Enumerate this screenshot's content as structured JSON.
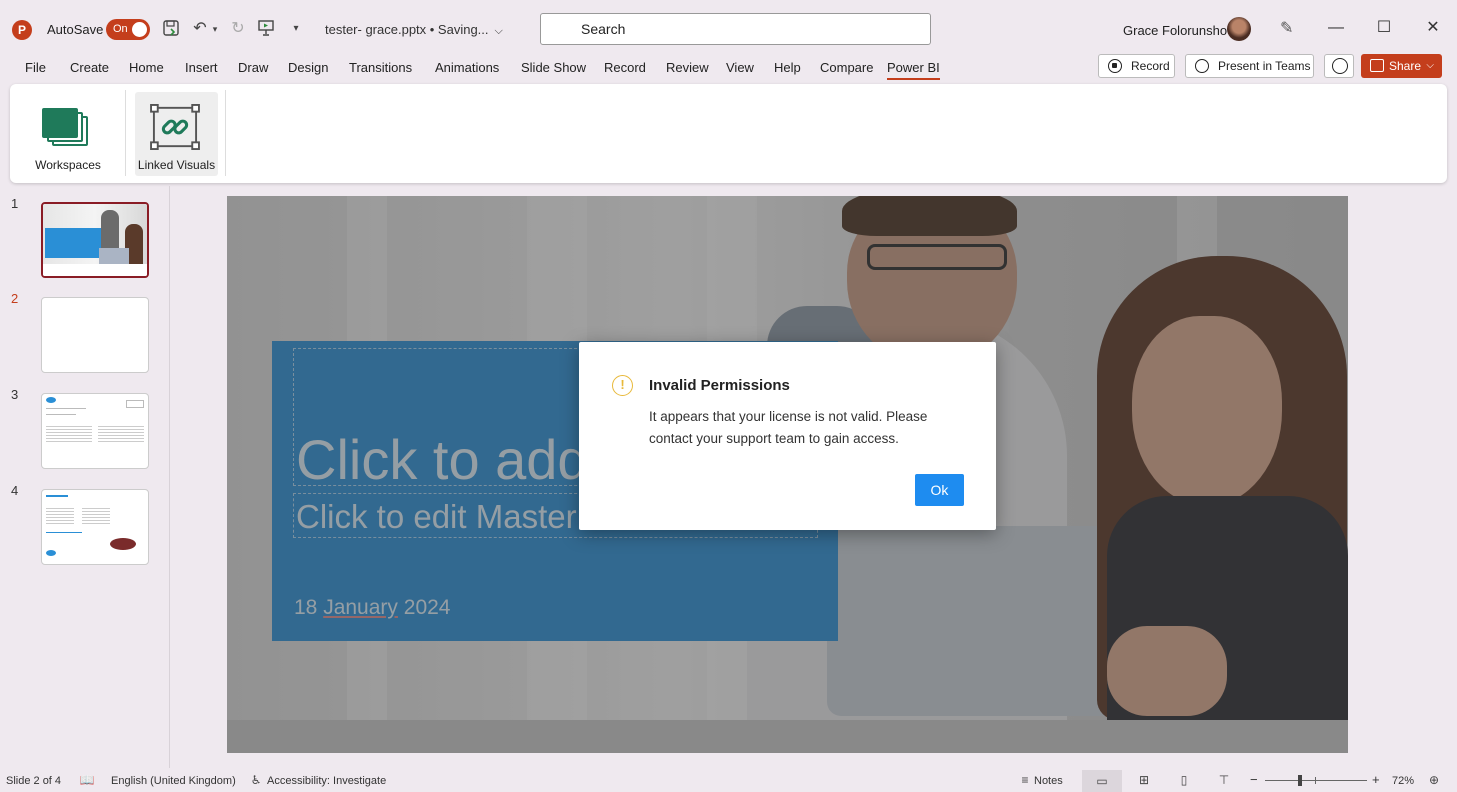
{
  "titlebar": {
    "app_logo": "P",
    "autosave_label": "AutoSave",
    "autosave_state": "On",
    "doc_title": "tester-  grace.pptx • Saving...",
    "search_placeholder": "Search",
    "user_name": "Grace Folorunsho",
    "window_controls": [
      "—",
      "☐",
      "✕"
    ]
  },
  "tabs": [
    "File",
    "Create",
    "Home",
    "Insert",
    "Draw",
    "Design",
    "Transitions",
    "Animations",
    "Slide Show",
    "Record",
    "Review",
    "View",
    "Help",
    "Compare",
    "Power BI"
  ],
  "active_tab": "Power BI",
  "actions": {
    "record_label": "Record",
    "present_label": "Present in Teams",
    "share_label": "Share"
  },
  "ribbon": {
    "workspaces_label": "Workspaces",
    "linked_visuals_label": "Linked Visuals"
  },
  "slides_panel": {
    "numbers": [
      "1",
      "2",
      "3",
      "4"
    ],
    "current": "2"
  },
  "slide": {
    "title_placeholder": "Click to add",
    "subtitle_placeholder": "Click to edit Master",
    "date_day": "18",
    "date_month": "January",
    "date_year": "2024"
  },
  "dialog": {
    "icon": "!",
    "title": "Invalid Permissions",
    "message": "It appears that your license is not valid. Please contact your support team to gain access.",
    "ok_label": "Ok"
  },
  "statusbar": {
    "slide_info": "Slide 2 of 4",
    "language": "English (United Kingdom)",
    "accessibility": "Accessibility: Investigate",
    "notes_label": "Notes",
    "zoom_minus": "−",
    "zoom_plus": "+",
    "zoom_level": "72%"
  },
  "colors": {
    "accent": "#c43e1c",
    "slide_thumb_border": "#8a1c25",
    "dialog_button": "#1e8cf0",
    "warning": "#e8b93a",
    "slide_blue": "#2a8fd6"
  }
}
